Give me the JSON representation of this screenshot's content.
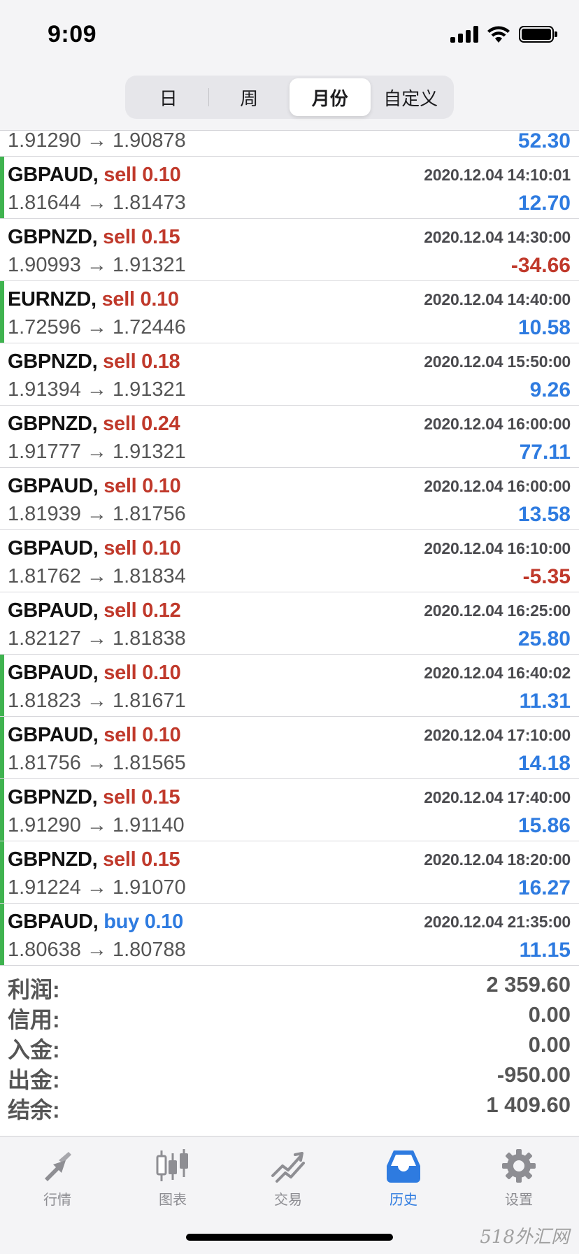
{
  "status": {
    "time": "9:09"
  },
  "segments": [
    {
      "label": "日",
      "active": false
    },
    {
      "label": "周",
      "active": false
    },
    {
      "label": "月份",
      "active": true
    },
    {
      "label": "自定义",
      "active": false
    }
  ],
  "trades": [
    {
      "symbol": "",
      "side": "",
      "lot": "",
      "time": "",
      "prices": "1.91290 → 1.90878",
      "profit": "52.30",
      "bar": false
    },
    {
      "symbol": "GBPAUD,",
      "side": "sell",
      "lot": "0.10",
      "time": "2020.12.04 14:10:01",
      "prices": "1.81644 → 1.81473",
      "profit": "12.70",
      "bar": true
    },
    {
      "symbol": "GBPNZD,",
      "side": "sell",
      "lot": "0.15",
      "time": "2020.12.04 14:30:00",
      "prices": "1.90993 → 1.91321",
      "profit": "-34.66",
      "bar": false
    },
    {
      "symbol": "EURNZD,",
      "side": "sell",
      "lot": "0.10",
      "time": "2020.12.04 14:40:00",
      "prices": "1.72596 → 1.72446",
      "profit": "10.58",
      "bar": true
    },
    {
      "symbol": "GBPNZD,",
      "side": "sell",
      "lot": "0.18",
      "time": "2020.12.04 15:50:00",
      "prices": "1.91394 → 1.91321",
      "profit": "9.26",
      "bar": false
    },
    {
      "symbol": "GBPNZD,",
      "side": "sell",
      "lot": "0.24",
      "time": "2020.12.04 16:00:00",
      "prices": "1.91777 → 1.91321",
      "profit": "77.11",
      "bar": false
    },
    {
      "symbol": "GBPAUD,",
      "side": "sell",
      "lot": "0.10",
      "time": "2020.12.04 16:00:00",
      "prices": "1.81939 → 1.81756",
      "profit": "13.58",
      "bar": false
    },
    {
      "symbol": "GBPAUD,",
      "side": "sell",
      "lot": "0.10",
      "time": "2020.12.04 16:10:00",
      "prices": "1.81762 → 1.81834",
      "profit": "-5.35",
      "bar": false
    },
    {
      "symbol": "GBPAUD,",
      "side": "sell",
      "lot": "0.12",
      "time": "2020.12.04 16:25:00",
      "prices": "1.82127 → 1.81838",
      "profit": "25.80",
      "bar": false
    },
    {
      "symbol": "GBPAUD,",
      "side": "sell",
      "lot": "0.10",
      "time": "2020.12.04 16:40:02",
      "prices": "1.81823 → 1.81671",
      "profit": "11.31",
      "bar": true
    },
    {
      "symbol": "GBPAUD,",
      "side": "sell",
      "lot": "0.10",
      "time": "2020.12.04 17:10:00",
      "prices": "1.81756 → 1.81565",
      "profit": "14.18",
      "bar": true
    },
    {
      "symbol": "GBPNZD,",
      "side": "sell",
      "lot": "0.15",
      "time": "2020.12.04 17:40:00",
      "prices": "1.91290 → 1.91140",
      "profit": "15.86",
      "bar": true
    },
    {
      "symbol": "GBPNZD,",
      "side": "sell",
      "lot": "0.15",
      "time": "2020.12.04 18:20:00",
      "prices": "1.91224 → 1.91070",
      "profit": "16.27",
      "bar": true
    },
    {
      "symbol": "GBPAUD,",
      "side": "buy",
      "lot": "0.10",
      "time": "2020.12.04 21:35:00",
      "prices": "1.80638 → 1.80788",
      "profit": "11.15",
      "bar": true
    }
  ],
  "summary": [
    {
      "label": "利润:",
      "value": "2 359.60"
    },
    {
      "label": "信用:",
      "value": "0.00"
    },
    {
      "label": "入金:",
      "value": "0.00"
    },
    {
      "label": "出金:",
      "value": "-950.00"
    },
    {
      "label": "结余:",
      "value": "1 409.60"
    }
  ],
  "tabs": [
    {
      "label": "行情",
      "icon": "quotes-icon",
      "active": false
    },
    {
      "label": "图表",
      "icon": "chart-icon",
      "active": false
    },
    {
      "label": "交易",
      "icon": "trade-icon",
      "active": false
    },
    {
      "label": "历史",
      "icon": "history-icon",
      "active": true
    },
    {
      "label": "设置",
      "icon": "settings-icon",
      "active": false
    }
  ],
  "watermark": "518外汇网",
  "colors": {
    "sell": "#c0392b",
    "buy": "#2e7be0",
    "profit_positive": "#2e7be0",
    "profit_negative": "#c0392b",
    "active_tab": "#2e7be0",
    "row_marker": "#3fb34f"
  }
}
